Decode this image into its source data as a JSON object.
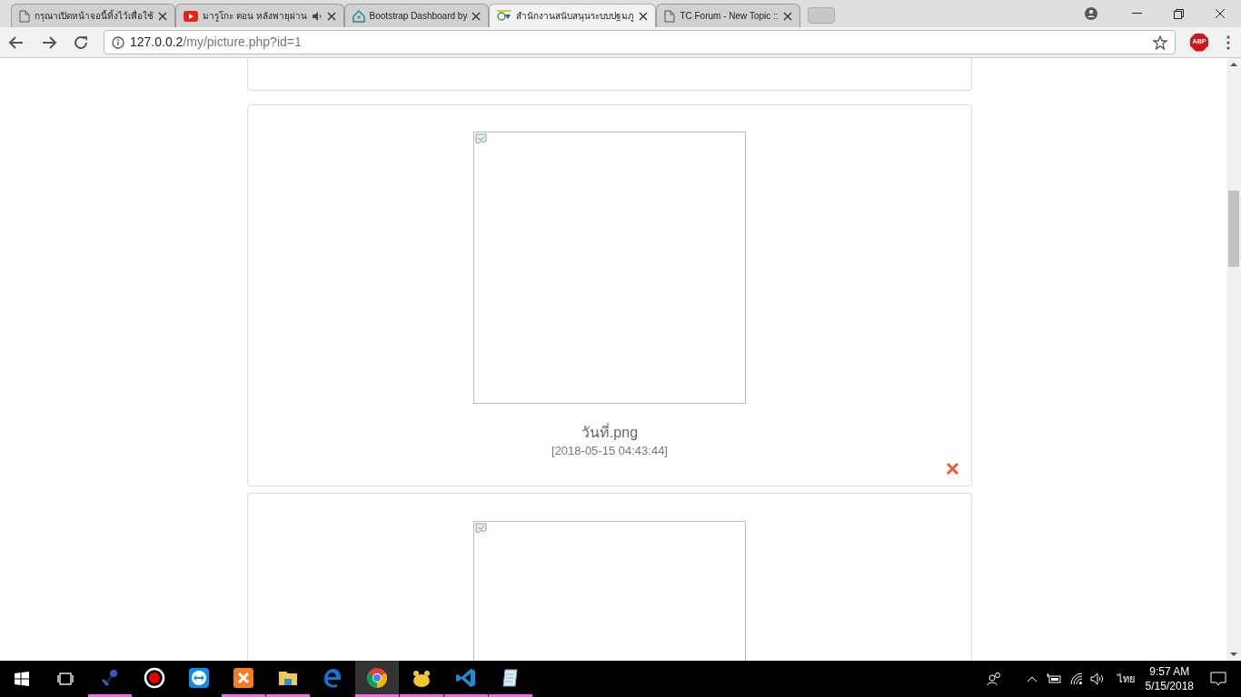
{
  "tabs": [
    {
      "title": "กรุณาเปิดหน้าจอนี้ทิ้งไว้เพื่อใช้",
      "kind": "page",
      "audio": false,
      "selected": false
    },
    {
      "title": "มารูโกะ ตอน หลังพายุผ่าน",
      "kind": "youtube",
      "audio": true,
      "selected": false
    },
    {
      "title": "Bootstrap Dashboard by",
      "kind": "house",
      "audio": false,
      "selected": false
    },
    {
      "title": "สำนักงานสนับสนุนระบบปฐมภู",
      "kind": "logo",
      "audio": false,
      "selected": true
    },
    {
      "title": "TC Forum - New Topic ::",
      "kind": "page",
      "audio": false,
      "selected": false
    }
  ],
  "address": {
    "host": "127.0.0.2",
    "path": "/my/picture.php?id=1"
  },
  "extension": "ABP",
  "cards": [
    {
      "kind": "partial-bottom"
    },
    {
      "kind": "picture",
      "filename": "วันที่.png",
      "timestamp": "[2018-05-15 04:43:44]"
    },
    {
      "kind": "partial-top"
    }
  ],
  "taskbar": {
    "apps": [
      {
        "kind": "mic",
        "running": true,
        "selected": false
      },
      {
        "kind": "record",
        "running": false,
        "selected": false
      },
      {
        "kind": "teamviewer",
        "running": false,
        "selected": false
      },
      {
        "kind": "xampp",
        "running": true,
        "selected": false
      },
      {
        "kind": "folder",
        "running": true,
        "selected": false
      },
      {
        "kind": "edge",
        "running": false,
        "selected": false
      },
      {
        "kind": "chrome",
        "running": true,
        "selected": true
      },
      {
        "kind": "yellow",
        "running": true,
        "selected": false
      },
      {
        "kind": "vscode",
        "running": true,
        "selected": false
      },
      {
        "kind": "notepad",
        "running": true,
        "selected": false
      }
    ],
    "language": "ไทย",
    "time": "9:57 AM",
    "date": "5/15/2018"
  }
}
